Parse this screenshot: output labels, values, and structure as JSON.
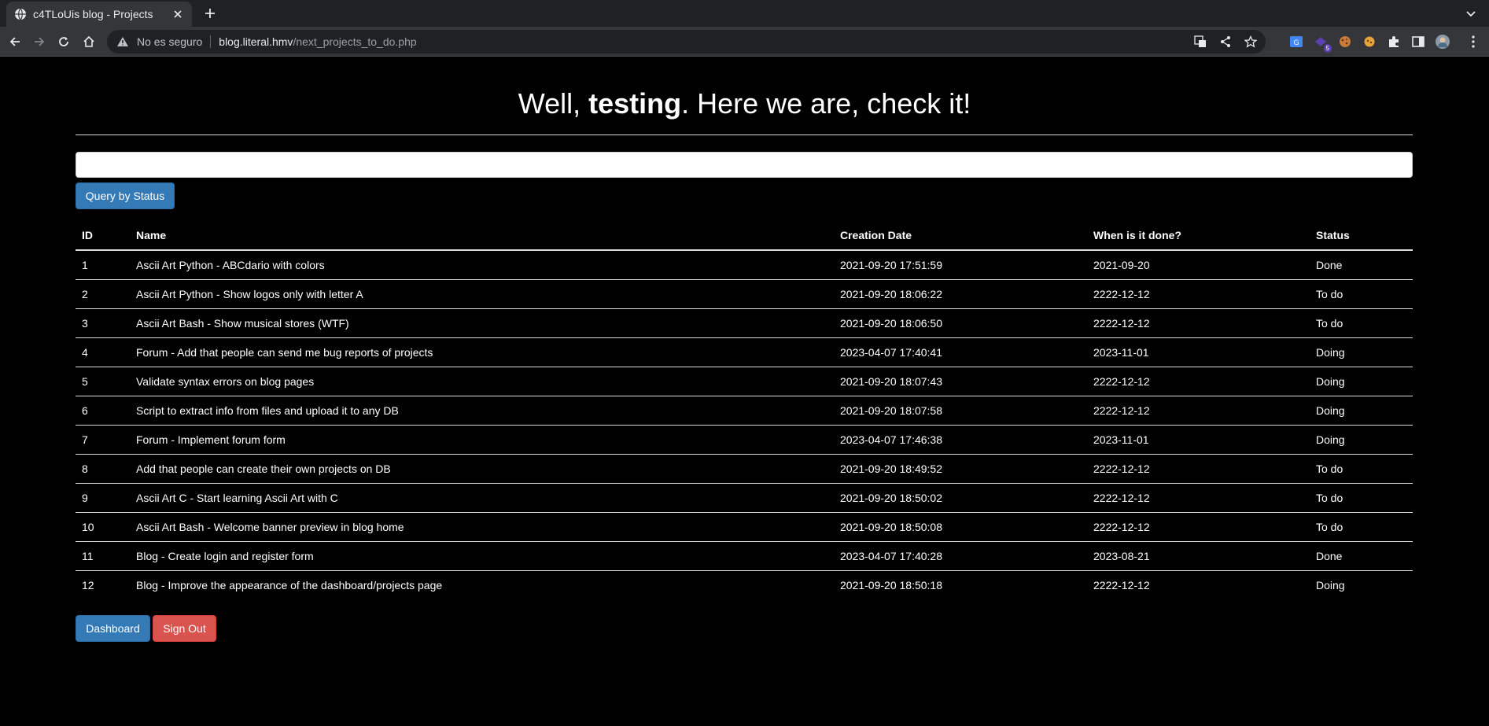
{
  "browser": {
    "tab_title": "c4TLoUis blog - Projects",
    "security_label": "No es seguro",
    "url_host": "blog.literal.hmv",
    "url_path": "/next_projects_to_do.php",
    "extension_badge": "5"
  },
  "page": {
    "heading_prefix": "Well, ",
    "heading_user": "testing",
    "heading_suffix": ". Here we are, check it!",
    "query_input_value": "",
    "query_button": "Query by Status",
    "columns": [
      "ID",
      "Name",
      "Creation Date",
      "When is it done?",
      "Status"
    ],
    "rows": [
      {
        "id": "1",
        "name": "Ascii Art Python - ABCdario with colors",
        "created": "2021-09-20 17:51:59",
        "done": "2021-09-20",
        "status": "Done"
      },
      {
        "id": "2",
        "name": "Ascii Art Python - Show logos only with letter A",
        "created": "2021-09-20 18:06:22",
        "done": "2222-12-12",
        "status": "To do"
      },
      {
        "id": "3",
        "name": "Ascii Art Bash - Show musical stores (WTF)",
        "created": "2021-09-20 18:06:50",
        "done": "2222-12-12",
        "status": "To do"
      },
      {
        "id": "4",
        "name": "Forum - Add that people can send me bug reports of projects",
        "created": "2023-04-07 17:40:41",
        "done": "2023-11-01",
        "status": "Doing"
      },
      {
        "id": "5",
        "name": "Validate syntax errors on blog pages",
        "created": "2021-09-20 18:07:43",
        "done": "2222-12-12",
        "status": "Doing"
      },
      {
        "id": "6",
        "name": "Script to extract info from files and upload it to any DB",
        "created": "2021-09-20 18:07:58",
        "done": "2222-12-12",
        "status": "Doing"
      },
      {
        "id": "7",
        "name": "Forum - Implement forum form",
        "created": "2023-04-07 17:46:38",
        "done": "2023-11-01",
        "status": "Doing"
      },
      {
        "id": "8",
        "name": "Add that people can create their own projects on DB",
        "created": "2021-09-20 18:49:52",
        "done": "2222-12-12",
        "status": "To do"
      },
      {
        "id": "9",
        "name": "Ascii Art C - Start learning Ascii Art with C",
        "created": "2021-09-20 18:50:02",
        "done": "2222-12-12",
        "status": "To do"
      },
      {
        "id": "10",
        "name": "Ascii Art Bash - Welcome banner preview in blog home",
        "created": "2021-09-20 18:50:08",
        "done": "2222-12-12",
        "status": "To do"
      },
      {
        "id": "11",
        "name": "Blog - Create login and register form",
        "created": "2023-04-07 17:40:28",
        "done": "2023-08-21",
        "status": "Done"
      },
      {
        "id": "12",
        "name": "Blog - Improve the appearance of the dashboard/projects page",
        "created": "2021-09-20 18:50:18",
        "done": "2222-12-12",
        "status": "Doing"
      }
    ],
    "dashboard_button": "Dashboard",
    "signout_button": "Sign Out"
  },
  "colors": {
    "primary": "#337ab7",
    "danger": "#d9534f",
    "page_bg": "#000000",
    "chrome_bg": "#35363a"
  }
}
